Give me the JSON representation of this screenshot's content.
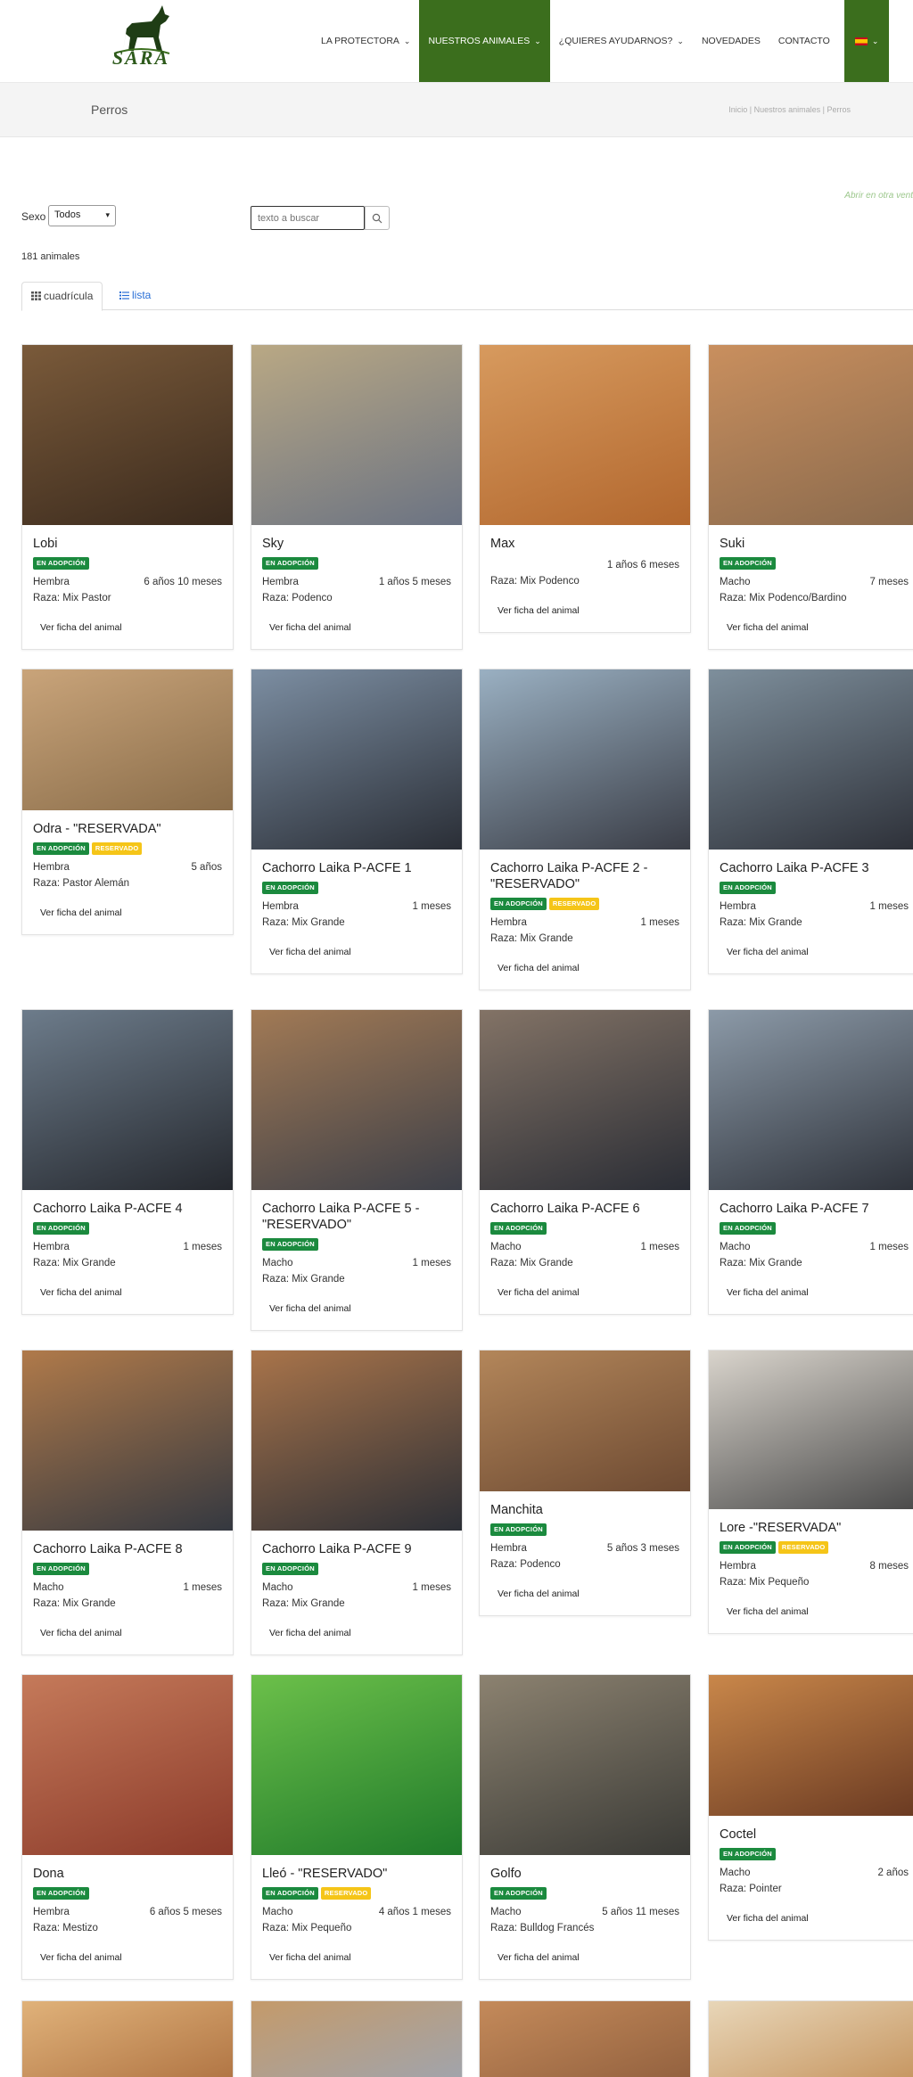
{
  "brand": {
    "logo_text": "SARA"
  },
  "nav": [
    {
      "label": "LA PROTECTORA",
      "chevron": true,
      "active": false
    },
    {
      "label": "NUESTROS ANIMALES",
      "chevron": true,
      "active": true
    },
    {
      "label": "¿QUIERES AYUDARNOS?",
      "chevron": true,
      "active": false
    },
    {
      "label": "NOVEDADES",
      "chevron": false,
      "active": false
    },
    {
      "label": "CONTACTO",
      "chevron": false,
      "active": false
    }
  ],
  "page": {
    "title": "Perros",
    "breadcrumb": [
      "Inicio",
      "Nuestros animales",
      "Perros"
    ],
    "open_new": "Abrir en otra vent"
  },
  "filters": {
    "sexo_label": "Sexo",
    "sexo_value": "Todos",
    "search_placeholder": "texto a buscar"
  },
  "count": {
    "number": "181",
    "label": "animales"
  },
  "tabs": {
    "grid": "cuadrícula",
    "list": "lista"
  },
  "colors": {
    "nav_active": "#3b6e1d",
    "badge_adopcion": "#1b8a3e",
    "badge_reservado": "#f5c518",
    "link": "#2a6fd6"
  },
  "animals": [
    {
      "name": "Lobi",
      "badges": [
        "EN ADOPCIÓN"
      ],
      "sex": "Hembra",
      "age": "6 años 10 meses",
      "breed": "Raza: Mix Pastor",
      "button": "Ver ficha del animal"
    },
    {
      "name": "Sky",
      "badges": [
        "EN ADOPCIÓN"
      ],
      "sex": "Hembra",
      "age": "1 años 5 meses",
      "breed": "Raza: Podenco",
      "button": "Ver ficha del animal"
    },
    {
      "name": "Max",
      "badges": [],
      "sex": "",
      "age": "1 años 6 meses",
      "breed": "Raza: Mix Podenco",
      "button": "Ver ficha del animal"
    },
    {
      "name": "Suki",
      "badges": [
        "EN ADOPCIÓN"
      ],
      "sex": "Macho",
      "age": "7 meses",
      "breed": "Raza: Mix Podenco/Bardino",
      "button": "Ver ficha del animal"
    },
    {
      "name": "Odra - \"RESERVADA\"",
      "badges": [
        "EN ADOPCIÓN",
        "RESERVADO"
      ],
      "sex": "Hembra",
      "age": "5 años",
      "breed": "Raza: Pastor Alemán",
      "button": "Ver ficha del animal"
    },
    {
      "name": "Cachorro Laika P-ACFE 1",
      "badges": [
        "EN ADOPCIÓN"
      ],
      "sex": "Hembra",
      "age": "1 meses",
      "breed": "Raza: Mix Grande",
      "button": "Ver ficha del animal"
    },
    {
      "name": "Cachorro Laika P-ACFE 2 - \"RESERVADO\"",
      "badges": [
        "EN ADOPCIÓN",
        "RESERVADO"
      ],
      "sex": "Hembra",
      "age": "1 meses",
      "breed": "Raza: Mix Grande",
      "button": "Ver ficha del animal"
    },
    {
      "name": "Cachorro Laika P-ACFE 3",
      "badges": [
        "EN ADOPCIÓN"
      ],
      "sex": "Hembra",
      "age": "1 meses",
      "breed": "Raza: Mix Grande",
      "button": "Ver ficha del animal"
    },
    {
      "name": "Cachorro Laika P-ACFE 4",
      "badges": [
        "EN ADOPCIÓN"
      ],
      "sex": "Hembra",
      "age": "1 meses",
      "breed": "Raza: Mix Grande",
      "button": "Ver ficha del animal"
    },
    {
      "name": "Cachorro Laika P-ACFE 5 - \"RESERVADO\"",
      "badges": [
        "EN ADOPCIÓN"
      ],
      "sex": "Macho",
      "age": "1 meses",
      "breed": "Raza: Mix Grande",
      "button": "Ver ficha del animal"
    },
    {
      "name": "Cachorro Laika P-ACFE 6",
      "badges": [
        "EN ADOPCIÓN"
      ],
      "sex": "Macho",
      "age": "1 meses",
      "breed": "Raza: Mix Grande",
      "button": "Ver ficha del animal"
    },
    {
      "name": "Cachorro Laika P-ACFE 7",
      "badges": [
        "EN ADOPCIÓN"
      ],
      "sex": "Macho",
      "age": "1 meses",
      "breed": "Raza: Mix Grande",
      "button": "Ver ficha del animal"
    },
    {
      "name": "Cachorro Laika P-ACFE 8",
      "badges": [
        "EN ADOPCIÓN"
      ],
      "sex": "Macho",
      "age": "1 meses",
      "breed": "Raza: Mix Grande",
      "button": "Ver ficha del animal"
    },
    {
      "name": "Cachorro Laika P-ACFE 9",
      "badges": [
        "EN ADOPCIÓN"
      ],
      "sex": "Macho",
      "age": "1 meses",
      "breed": "Raza: Mix Grande",
      "button": "Ver ficha del animal"
    },
    {
      "name": "Manchita",
      "badges": [
        "EN ADOPCIÓN"
      ],
      "sex": "Hembra",
      "age": "5 años 3 meses",
      "breed": "Raza: Podenco",
      "button": "Ver ficha del animal"
    },
    {
      "name": "Lore -\"RESERVADA\"",
      "badges": [
        "EN ADOPCIÓN",
        "RESERVADO"
      ],
      "sex": "Hembra",
      "age": "8 meses",
      "breed": "Raza: Mix Pequeño",
      "button": "Ver ficha del animal"
    },
    {
      "name": "Dona",
      "badges": [
        "EN ADOPCIÓN"
      ],
      "sex": "Hembra",
      "age": "6 años 5 meses",
      "breed": "Raza: Mestizo",
      "button": "Ver ficha del animal"
    },
    {
      "name": "Lleó - \"RESERVADO\"",
      "badges": [
        "EN ADOPCIÓN",
        "RESERVADO"
      ],
      "sex": "Macho",
      "age": "4 años 1 meses",
      "breed": "Raza: Mix Pequeño",
      "button": "Ver ficha del animal"
    },
    {
      "name": "Golfo",
      "badges": [
        "EN ADOPCIÓN"
      ],
      "sex": "Macho",
      "age": "5 años 11 meses",
      "breed": "Raza: Bulldog Francés",
      "button": "Ver ficha del animal"
    },
    {
      "name": "Coctel",
      "badges": [
        "EN ADOPCIÓN"
      ],
      "sex": "Macho",
      "age": "2 años",
      "breed": "Raza: Pointer",
      "button": "Ver ficha del animal"
    },
    {
      "name": "",
      "badges": [],
      "sex": "",
      "age": "",
      "breed": "",
      "button": ""
    },
    {
      "name": "",
      "badges": [],
      "sex": "",
      "age": "",
      "breed": "",
      "button": ""
    },
    {
      "name": "",
      "badges": [],
      "sex": "",
      "age": "",
      "breed": "",
      "button": ""
    },
    {
      "name": "",
      "badges": [],
      "sex": "",
      "age": "",
      "breed": "",
      "button": ""
    }
  ]
}
